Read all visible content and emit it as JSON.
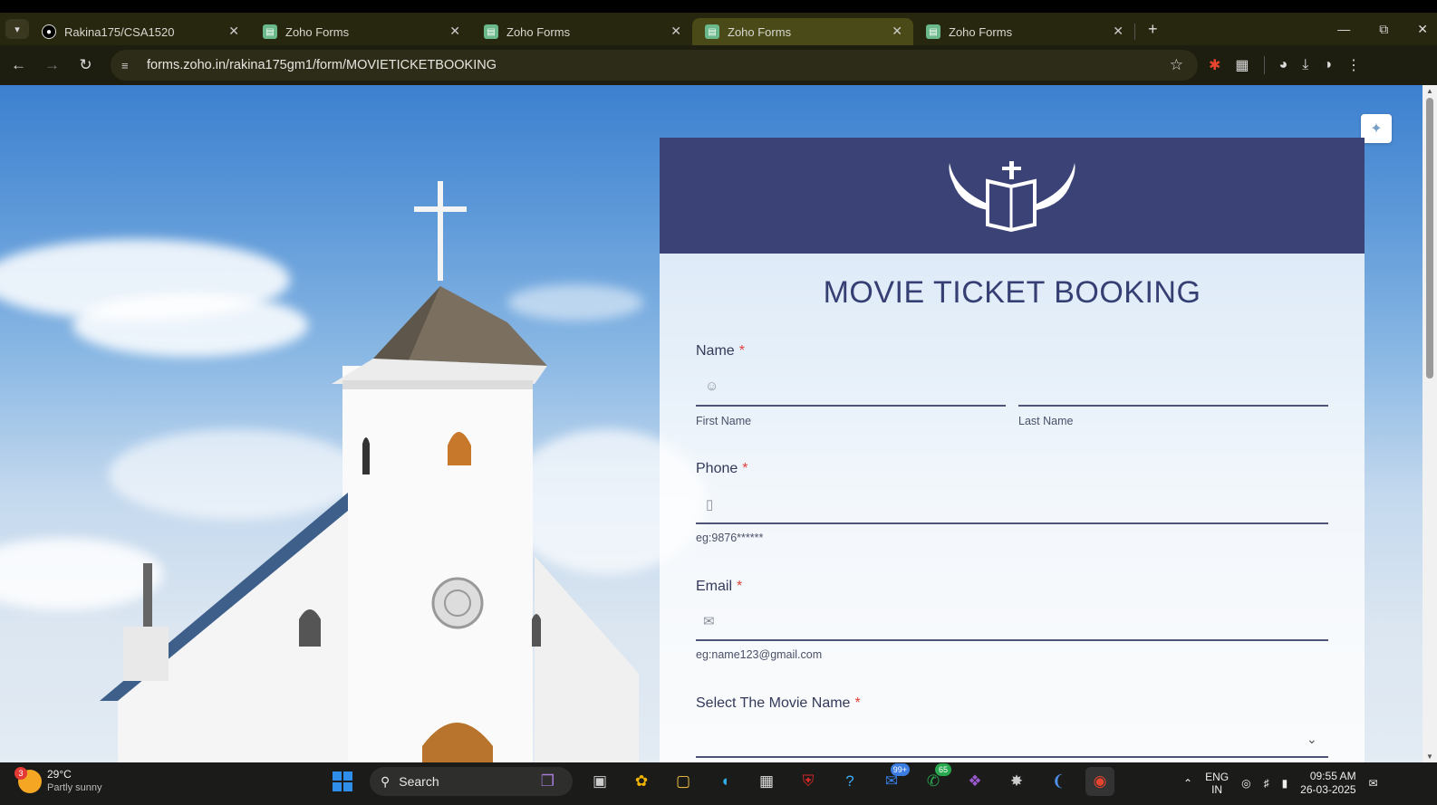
{
  "browser": {
    "tabs": [
      {
        "title": "Rakina175/CSA1520",
        "icon": "github-icon",
        "active": false
      },
      {
        "title": "Zoho Forms",
        "icon": "zoho-forms-icon",
        "active": false
      },
      {
        "title": "Zoho Forms",
        "icon": "zoho-forms-icon",
        "active": false
      },
      {
        "title": "Zoho Forms",
        "icon": "zoho-forms-icon",
        "active": true
      },
      {
        "title": "Zoho Forms",
        "icon": "zoho-forms-icon",
        "active": false
      }
    ],
    "url": "forms.zoho.in/rakina175gm1/form/MOVIETICKETBOOKING"
  },
  "form": {
    "title": "MOVIE TICKET BOOKING",
    "required_marker": "*",
    "name": {
      "label": "Name",
      "first_sub": "First Name",
      "last_sub": "Last Name"
    },
    "phone": {
      "label": "Phone",
      "hint": "eg:9876******"
    },
    "email": {
      "label": "Email",
      "hint": "eg:name123@gmail.com"
    },
    "movie": {
      "label": "Select The Movie Name"
    }
  },
  "taskbar": {
    "weather": {
      "badge": "3",
      "temp": "29°C",
      "condition": "Partly sunny"
    },
    "search_label": "Search",
    "badges": {
      "outlook": "99+",
      "whatsapp": "65"
    },
    "lang": {
      "top": "ENG",
      "bottom": "IN"
    },
    "time": "09:55 AM",
    "date": "26-03-2025"
  }
}
